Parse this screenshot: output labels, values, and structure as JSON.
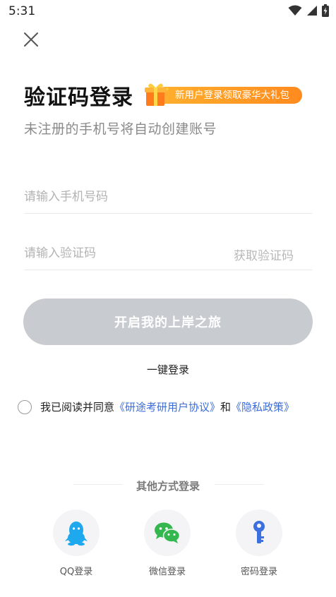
{
  "status_bar": {
    "time": "5:31"
  },
  "header": {
    "title": "验证码登录",
    "promo_label": "新用户登录领取豪华大礼包",
    "subtitle": "未注册的手机号将自动创建账号"
  },
  "form": {
    "phone_placeholder": "请输入手机号码",
    "code_placeholder": "请输入验证码",
    "get_code_label": "获取验证码",
    "submit_label": "开启我的上岸之旅"
  },
  "onekey_label": "一键登录",
  "agreement": {
    "prefix": "我已阅读并同意",
    "link1": "《研途考研用户协议》",
    "middle": "和",
    "link2": "《隐私政策》"
  },
  "other_login": {
    "title": "其他方式登录",
    "methods": [
      {
        "label": "QQ登录",
        "icon": "qq-icon",
        "color": "#1ea8ee"
      },
      {
        "label": "微信登录",
        "icon": "wechat-icon",
        "color": "#34b74f"
      },
      {
        "label": "密码登录",
        "icon": "key-icon",
        "color": "#3c6fe0"
      }
    ]
  },
  "colors": {
    "button_disabled": "#c8cbd0",
    "link": "#3b6cd8",
    "promo": "#ff9f26"
  }
}
